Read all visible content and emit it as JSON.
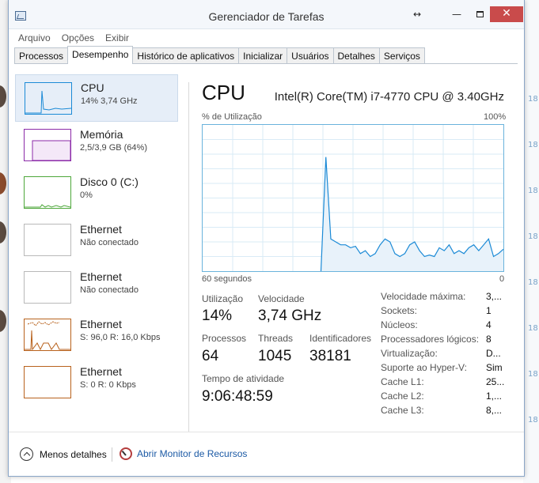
{
  "window": {
    "title": "Gerenciador de Tarefas",
    "resize_glyph": "↔",
    "minimize_glyph": "—",
    "close_glyph": "✕"
  },
  "menu": [
    "Arquivo",
    "Opções",
    "Exibir"
  ],
  "tabs": [
    {
      "label": "Processos",
      "active": false
    },
    {
      "label": "Desempenho",
      "active": true
    },
    {
      "label": "Histórico de aplicativos",
      "active": false
    },
    {
      "label": "Inicializar",
      "active": false
    },
    {
      "label": "Usuários",
      "active": false
    },
    {
      "label": "Detalhes",
      "active": false
    },
    {
      "label": "Serviços",
      "active": false
    }
  ],
  "resources": [
    {
      "name": "CPU",
      "sub": "14% 3,74 GHz",
      "color": "#1b8ad6"
    },
    {
      "name": "Memória",
      "sub": "2,5/3,9 GB (64%)",
      "color": "#8b2aa8"
    },
    {
      "name": "Disco 0 (C:)",
      "sub": "0%",
      "color": "#4da73a"
    },
    {
      "name": "Ethernet",
      "sub": "Não conectado",
      "color": "#b9b9b9"
    },
    {
      "name": "Ethernet",
      "sub": "Não conectado",
      "color": "#b9b9b9"
    },
    {
      "name": "Ethernet",
      "sub": "S: 96,0  R: 16,0 Kbps",
      "color": "#b8621d"
    },
    {
      "name": "Ethernet",
      "sub": "S: 0  R: 0 Kbps",
      "color": "#b8621d"
    }
  ],
  "main": {
    "title": "CPU",
    "cpu_model": "Intel(R) Core(TM) i7-4770 CPU @ 3.40GHz",
    "y_label": "% de Utilização",
    "y_max_label": "100%",
    "x_left_label": "60 segundos",
    "x_right_label": "0",
    "graph_color": "#1b8ad6",
    "utilization_series": [
      0,
      0,
      0,
      0,
      0,
      0,
      0,
      0,
      0,
      0,
      0,
      0,
      0,
      0,
      0,
      0,
      0,
      0,
      0,
      0,
      0,
      0,
      0,
      0,
      0,
      78,
      22,
      20,
      18,
      18,
      16,
      17,
      12,
      14,
      10,
      12,
      18,
      22,
      20,
      12,
      10,
      12,
      18,
      20,
      14,
      10,
      11,
      10,
      16,
      14,
      18,
      12,
      14,
      12,
      16,
      18,
      14,
      18,
      22,
      10,
      12,
      15
    ]
  },
  "stats": {
    "utilization_label": "Utilização",
    "utilization_value": "14%",
    "speed_label": "Velocidade",
    "speed_value": "3,74 GHz",
    "processes_label": "Processos",
    "processes_value": "64",
    "threads_label": "Threads",
    "threads_value": "1045",
    "handles_label": "Identificadores",
    "handles_value": "38181",
    "uptime_label": "Tempo de atividade",
    "uptime_value": "9:06:48:59"
  },
  "specs": [
    {
      "key": "Velocidade máxima:",
      "value": "3,..."
    },
    {
      "key": "Sockets:",
      "value": "1"
    },
    {
      "key": "Núcleos:",
      "value": "4"
    },
    {
      "key": "Processadores lógicos:",
      "value": "8"
    },
    {
      "key": "Virtualização:",
      "value": "D..."
    },
    {
      "key": "Suporte ao Hyper-V:",
      "value": "Sim"
    },
    {
      "key": "Cache L1:",
      "value": "25..."
    },
    {
      "key": "Cache L2:",
      "value": "1,..."
    },
    {
      "key": "Cache L3:",
      "value": "8,..."
    }
  ],
  "footer": {
    "less_details": "Menos detalhes",
    "resource_monitor": "Abrir Monitor de Recursos"
  },
  "background": {
    "right_numbers": [
      "18",
      "18",
      "18",
      "18",
      "18",
      "18",
      "18",
      "18"
    ]
  }
}
